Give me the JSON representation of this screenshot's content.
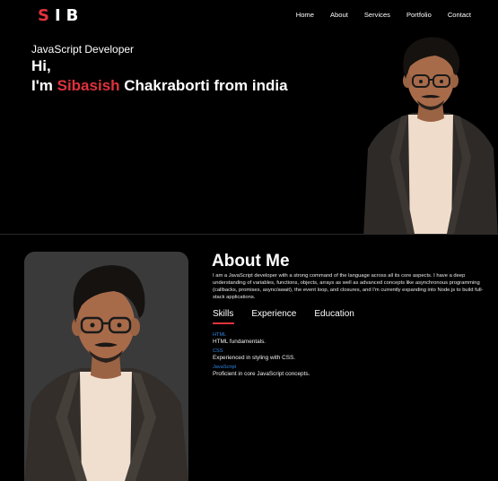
{
  "nav": {
    "logo_first": "S",
    "logo_rest": "IB",
    "links": [
      "Home",
      "About",
      "Services",
      "Portfolio",
      "Contact"
    ]
  },
  "hero": {
    "subtitle": "JavaScript Developer",
    "greeting": "Hi,",
    "im": "I'm ",
    "first_name": "Sibasish",
    "rest": " Chakraborti from india"
  },
  "about": {
    "title": "About Me",
    "description": "I am a JavaScript developer with a strong command of the language across all its core aspects. I have a deep understanding of variables, functions, objects, arrays as well as advanced concepts like asynchronous programming (callbacks, promises, async/await), the event loop, and closures, and I'm currently expanding into Node.js to build full-stack applications.",
    "tabs": [
      "Skills",
      "Experience",
      "Education"
    ],
    "skills": [
      {
        "name": "HTML",
        "desc": "HTML fundamentals."
      },
      {
        "name": "CSS",
        "desc": "Experienced in styling with CSS."
      },
      {
        "name": "JavaScript",
        "desc": "Proficient in core JavaScript concepts."
      }
    ]
  },
  "colors": {
    "accent": "#e0323d",
    "skill_name": "#2f86e0",
    "background": "#000000"
  }
}
